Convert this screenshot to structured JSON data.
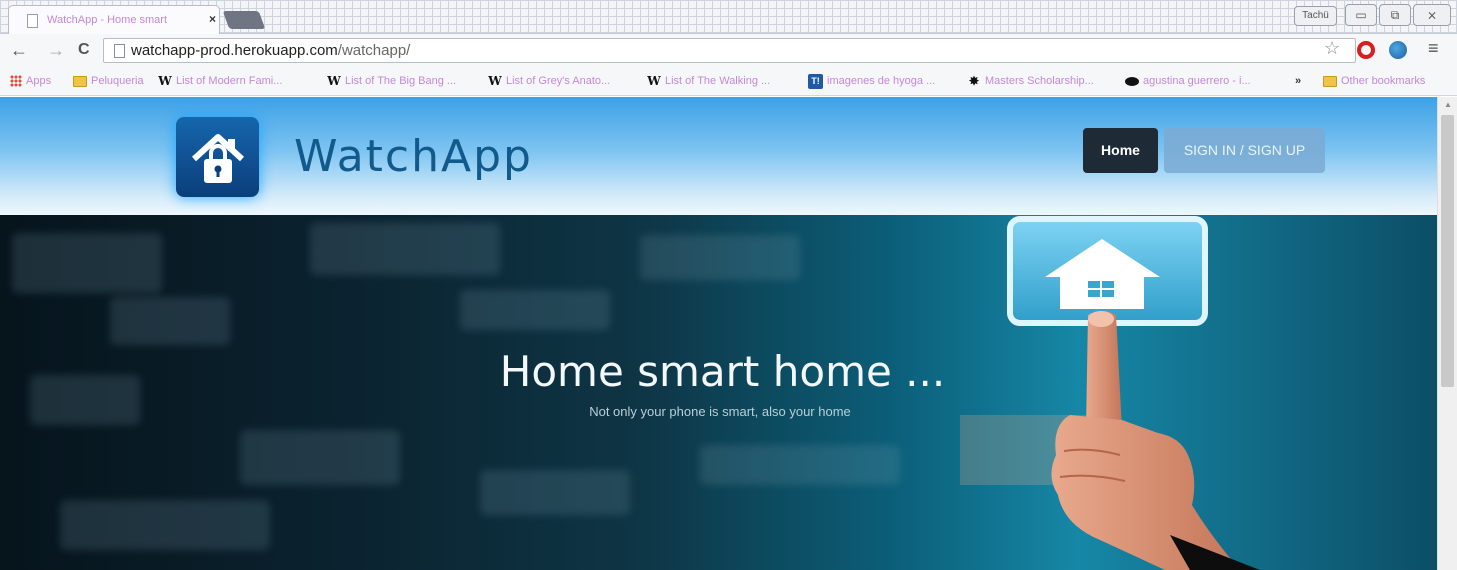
{
  "browser": {
    "tab": {
      "title": "WatchApp - Home smart",
      "close": "×"
    },
    "profile_name": "Tachü",
    "window_buttons": {
      "minimize": "▭",
      "maximize": "⧉",
      "close": "⨯"
    },
    "nav": {
      "back": "←",
      "forward": "→",
      "reload": "C"
    },
    "address": {
      "host": "watchapp-prod.herokuapp.com",
      "path": "/watchapp/"
    },
    "icons": [
      "star-icon",
      "opera-icon",
      "globe-icon",
      "menu-icon"
    ],
    "bookmarks": [
      {
        "label": "Apps",
        "icon": "apps-grid-icon"
      },
      {
        "label": "Peluqueria",
        "icon": "folder-icon"
      },
      {
        "label": "List of Modern Fami...",
        "icon": "wikipedia-icon"
      },
      {
        "label": "List of The Big Bang ...",
        "icon": "wikipedia-icon"
      },
      {
        "label": "List of Grey's Anato...",
        "icon": "wikipedia-icon"
      },
      {
        "label": "List of The Walking ...",
        "icon": "wikipedia-icon"
      },
      {
        "label": "imagenes de hyoga ...",
        "icon": "tb-icon"
      },
      {
        "label": "Masters Scholarship...",
        "icon": "splat-icon"
      },
      {
        "label": "agustina guerrero - i...",
        "icon": "blob-icon"
      }
    ],
    "bookmarks_overflow": "»",
    "other_bookmarks": "Other bookmarks",
    "wiki_glyph": "W",
    "tb_glyph": "T!"
  },
  "site": {
    "brand": "WatchApp",
    "nav": {
      "home": "Home",
      "signin": "SIGN IN / SIGN UP"
    },
    "hero": {
      "title": "Home smart home ...",
      "subtitle": "Not only your phone is smart, also your home"
    }
  },
  "colors": {
    "header_top": "#3ea1e6",
    "brand_text": "#125a8c",
    "home_button": "#1e2a35",
    "bookmark_text": "#c488d8"
  }
}
